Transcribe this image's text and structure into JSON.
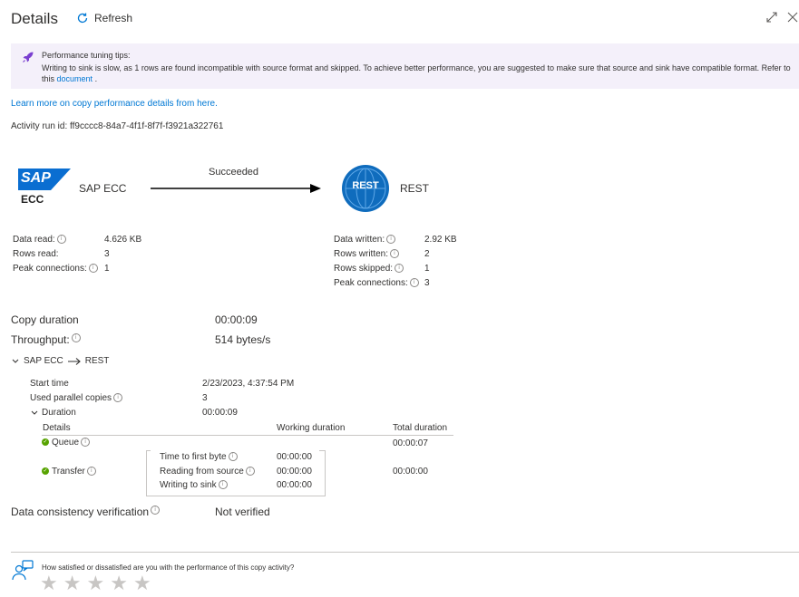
{
  "header": {
    "title": "Details",
    "refresh_label": "Refresh"
  },
  "tip": {
    "title": "Performance tuning tips:",
    "body": "Writing to sink is slow, as 1 rows are found incompatible with source format and skipped. To achieve better performance, you are suggested to make sure that source and sink have compatible format. Refer to this",
    "link": "document",
    "trail": " ."
  },
  "learn_more": "Learn more on copy performance details from here.",
  "activity": {
    "label": "Activity run id:",
    "id": "ff9cccc8-84a7-4f1f-8f7f-f3921a322761"
  },
  "flow": {
    "source_name": "SAP ECC",
    "source_logo_top": "SAP",
    "source_logo_bottom": "ECC",
    "status": "Succeeded",
    "sink_name": "REST",
    "sink_logo": "REST"
  },
  "source_stats": [
    {
      "label": "Data read:",
      "value": "4.626 KB",
      "info": true
    },
    {
      "label": "Rows read:",
      "value": "3",
      "info": false
    },
    {
      "label": "Peak connections:",
      "value": "1",
      "info": true
    }
  ],
  "sink_stats": [
    {
      "label": "Data written:",
      "value": "2.92 KB",
      "info": true
    },
    {
      "label": "Rows written:",
      "value": "2",
      "info": true
    },
    {
      "label": "Rows skipped:",
      "value": "1",
      "info": true
    },
    {
      "label": "Peak connections:",
      "value": "3",
      "info": true
    }
  ],
  "summary": {
    "copy_duration_label": "Copy duration",
    "copy_duration_value": "00:00:09",
    "throughput_label": "Throughput:",
    "throughput_value": "514 bytes/s"
  },
  "route": {
    "source": "SAP ECC",
    "sink": "REST"
  },
  "run": {
    "start_label": "Start time",
    "start_value": "2/23/2023, 4:37:54 PM",
    "parallel_label": "Used parallel copies",
    "parallel_value": "3",
    "duration_label": "Duration",
    "duration_value": "00:00:09"
  },
  "duration_table": {
    "col_details": "Details",
    "col_working": "Working duration",
    "col_total": "Total duration",
    "queue_label": "Queue",
    "queue_total": "00:00:07",
    "transfer_label": "Transfer",
    "transfer_total": "00:00:00",
    "steps": [
      {
        "label": "Time to first byte",
        "value": "00:00:00"
      },
      {
        "label": "Reading from source",
        "value": "00:00:00"
      },
      {
        "label": "Writing to sink",
        "value": "00:00:00"
      }
    ]
  },
  "consistency": {
    "label": "Data consistency verification",
    "value": "Not verified"
  },
  "feedback": {
    "question": "How satisfied or dissatisfied are you with the performance of this copy activity?",
    "stars": 5
  },
  "colors": {
    "accent": "#0078d4",
    "tip_bg": "#f4f0fa",
    "sap_blue": "#0a6ed1",
    "rest_blue": "#0f6cbd",
    "success": "#57a300"
  }
}
